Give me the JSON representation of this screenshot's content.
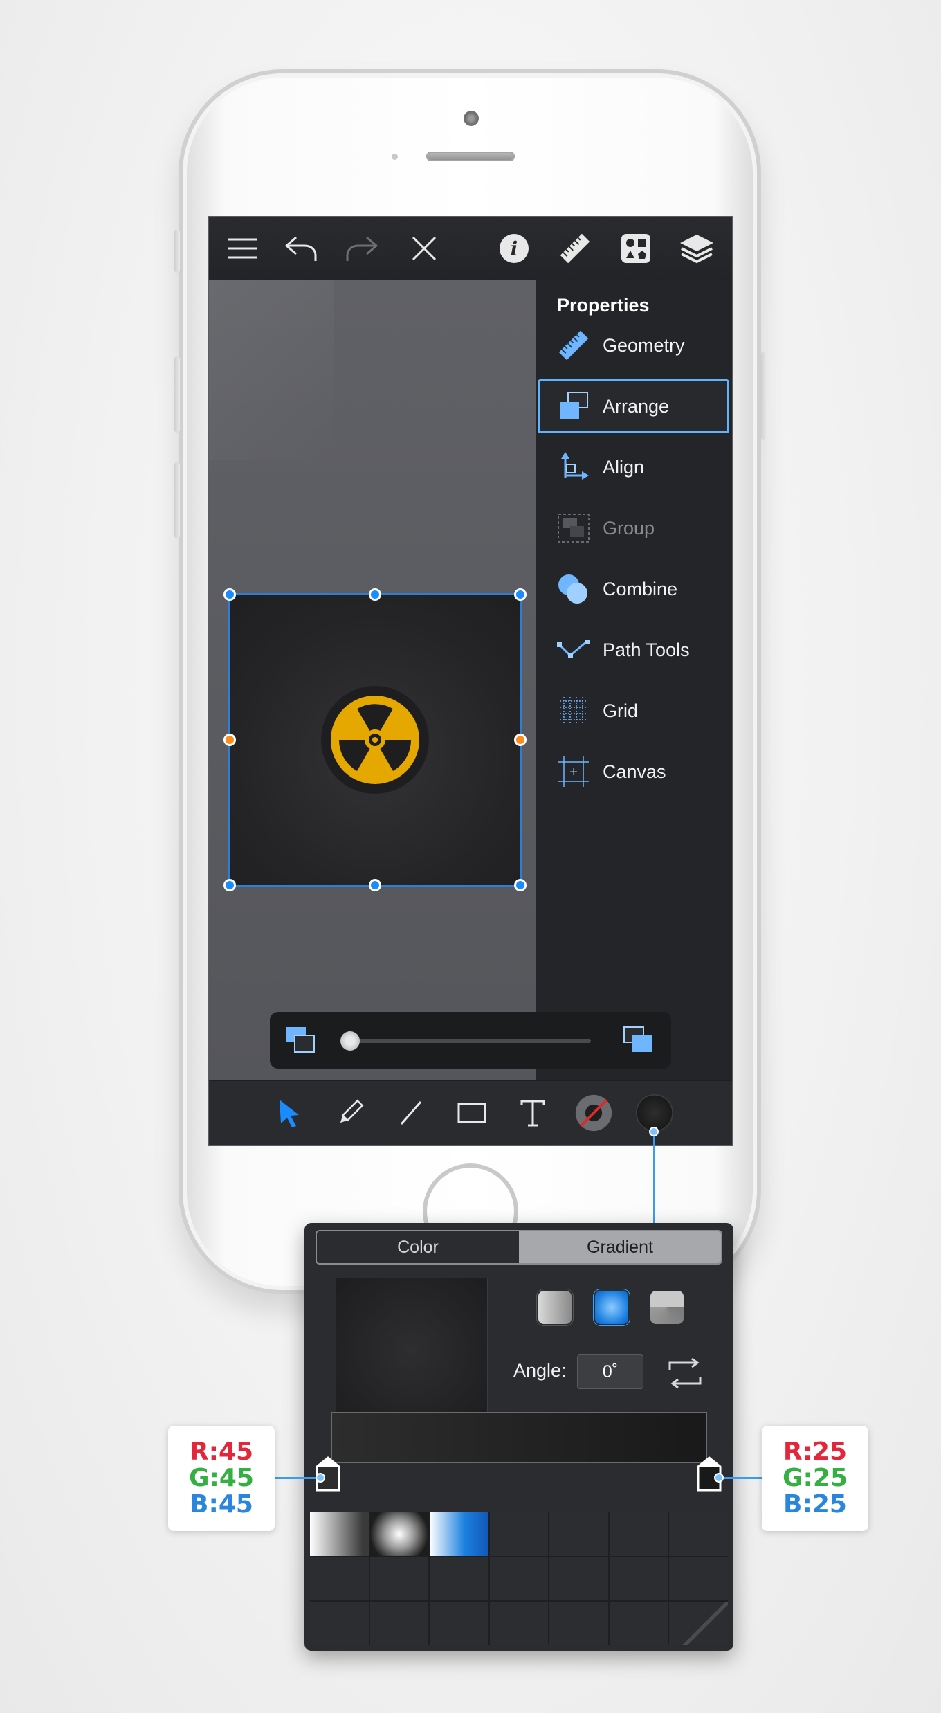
{
  "panel": {
    "title": "Properties",
    "items": [
      {
        "label": "Geometry",
        "icon": "ruler-icon",
        "state": "normal"
      },
      {
        "label": "Arrange",
        "icon": "arrange-icon",
        "state": "selected"
      },
      {
        "label": "Align",
        "icon": "align-icon",
        "state": "normal"
      },
      {
        "label": "Group",
        "icon": "group-icon",
        "state": "disabled"
      },
      {
        "label": "Combine",
        "icon": "combine-icon",
        "state": "normal"
      },
      {
        "label": "Path Tools",
        "icon": "path-tools-icon",
        "state": "normal"
      },
      {
        "label": "Grid",
        "icon": "grid-icon",
        "state": "normal"
      },
      {
        "label": "Canvas",
        "icon": "canvas-icon",
        "state": "normal"
      }
    ]
  },
  "topbar": {
    "icons": [
      "menu-icon",
      "undo-icon",
      "redo-icon",
      "close-icon",
      "info-icon",
      "ruler-icon",
      "shapes-icon",
      "layers-icon"
    ]
  },
  "toolbar": {
    "icons": [
      "select-arrow-icon",
      "pencil-icon",
      "line-icon",
      "rectangle-icon",
      "text-icon",
      "stroke-icon",
      "fill-icon"
    ]
  },
  "arrange_slider": {
    "value": 0
  },
  "gradient_panel": {
    "tabs": {
      "color": "Color",
      "gradient": "Gradient",
      "active": "gradient"
    },
    "types": [
      "linear-gradient-icon",
      "radial-gradient-icon",
      "conical-gradient-icon"
    ],
    "active_type": "radial",
    "angle_label": "Angle:",
    "angle_value": "0˚",
    "stops": [
      {
        "r": "R:45",
        "g": "G:45",
        "b": "B:45"
      },
      {
        "r": "R:25",
        "g": "G:25",
        "b": "B:25"
      }
    ]
  },
  "colors": {
    "accent": "#1a8cff",
    "selection_highlight": "#5fb4ff",
    "handle_mid": "#ff8c1a",
    "radiation_yellow": "#e5a800"
  }
}
